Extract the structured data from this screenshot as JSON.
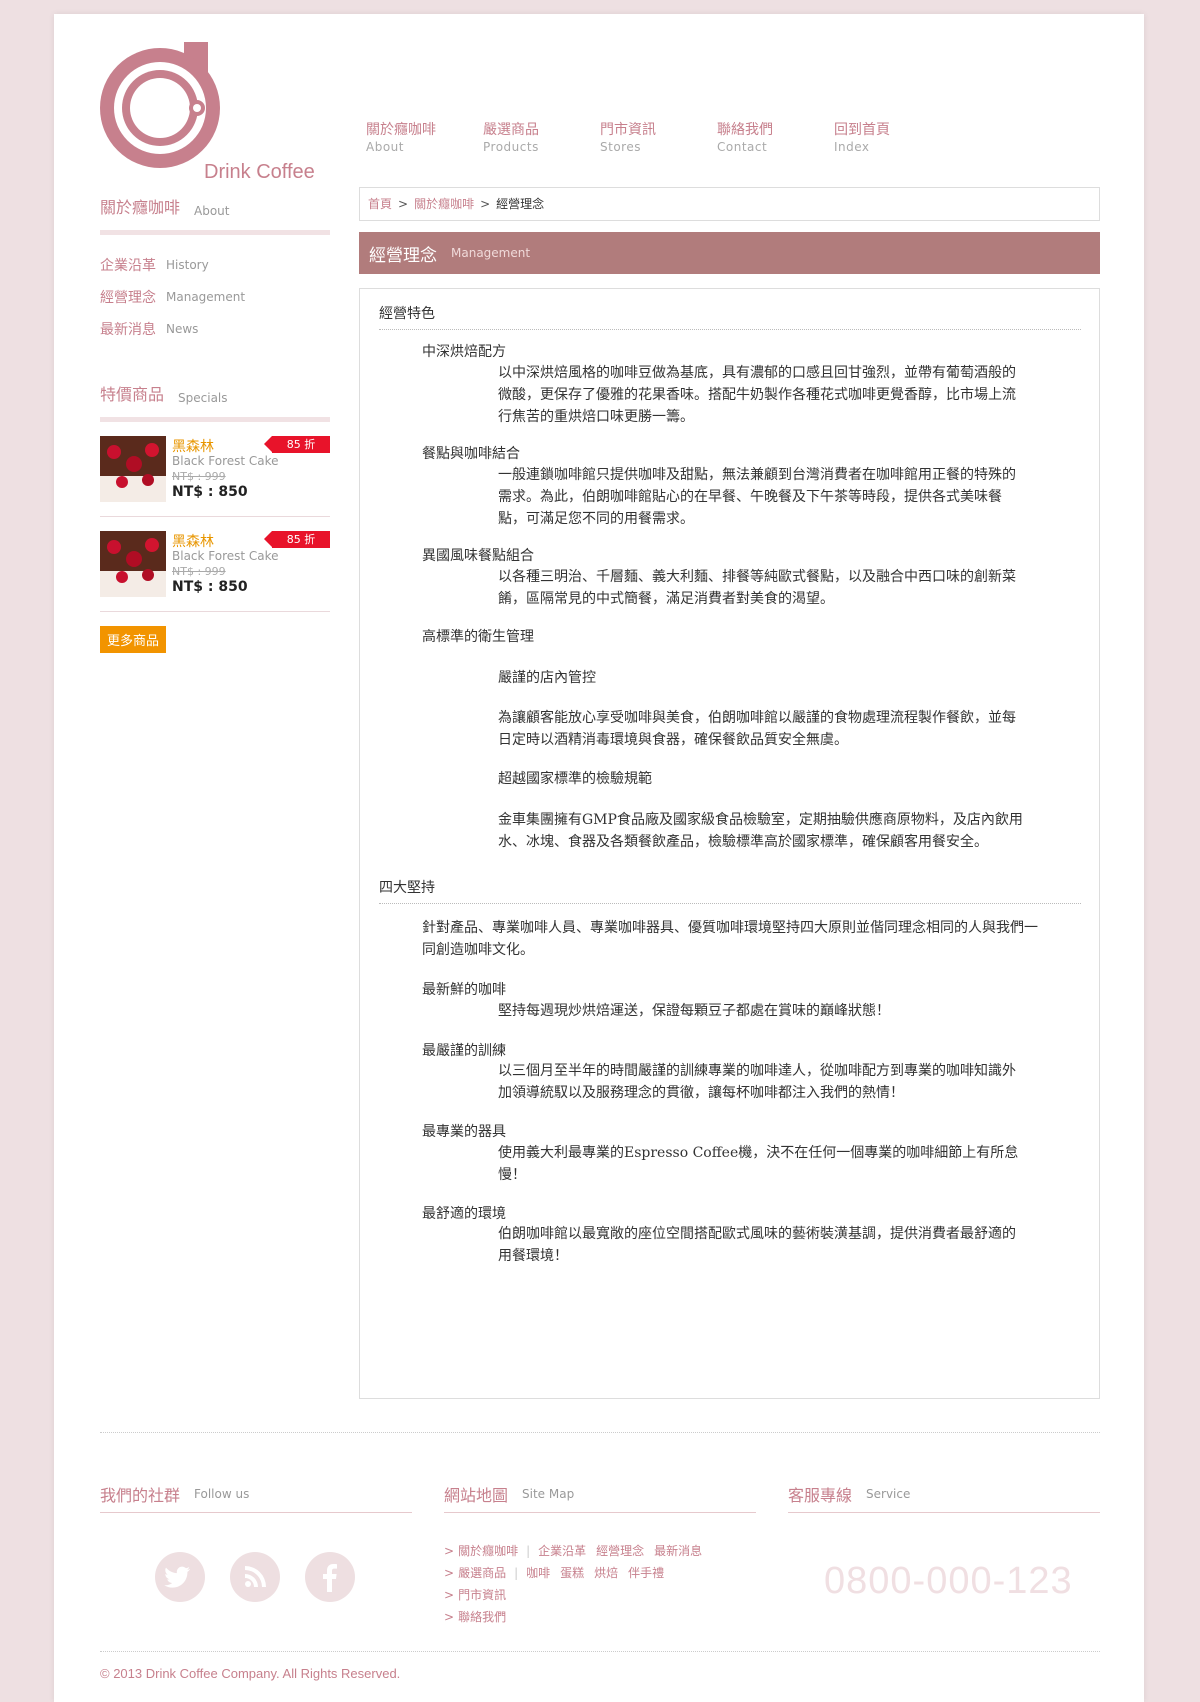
{
  "brand": {
    "name": "Drink Coffee"
  },
  "nav": [
    {
      "zh": "關於癮咖啡",
      "en": "About"
    },
    {
      "zh": "嚴選商品",
      "en": "Products"
    },
    {
      "zh": "門市資訊",
      "en": "Stores"
    },
    {
      "zh": "聯絡我們",
      "en": "Contact"
    },
    {
      "zh": "回到首頁",
      "en": "Index"
    }
  ],
  "sidebar": {
    "about": {
      "zh": "關於癮咖啡",
      "en": "About"
    },
    "menu": [
      {
        "zh": "企業沿革",
        "en": "History"
      },
      {
        "zh": "經營理念",
        "en": "Management"
      },
      {
        "zh": "最新消息",
        "en": "News"
      }
    ],
    "specials": {
      "zh": "特價商品",
      "en": "Specials"
    },
    "products": [
      {
        "name": "黑森林",
        "en": "Black Forest Cake",
        "old": "NT$ : 999",
        "price": "NT$ : 850",
        "badge": "85 折"
      },
      {
        "name": "黑森林",
        "en": "Black Forest Cake",
        "old": "NT$ : 999",
        "price": "NT$ : 850",
        "badge": "85 折"
      }
    ],
    "more": "更多商品"
  },
  "breadcrumb": {
    "home": "首頁",
    "sep": ">",
    "parent": "關於癮咖啡",
    "current": "經營理念"
  },
  "title": {
    "zh": "經營理念",
    "en": "Management"
  },
  "content": {
    "sec1": "經營特色",
    "s1": {
      "t1": "中深烘焙配方",
      "p1": "以中深烘焙風格的咖啡豆做為基底，具有濃郁的口感且回甘強烈，並帶有葡萄酒般的微酸，更保存了優雅的花果香味。搭配牛奶製作各種花式咖啡更覺香醇，比市場上流行焦苦的重烘焙口味更勝一籌。",
      "t2": "餐點與咖啡結合",
      "p2": "一般連鎖咖啡館只提供咖啡及甜點，無法兼顧到台灣消費者在咖啡館用正餐的特殊的需求。為此，伯朗咖啡館貼心的在早餐、午晚餐及下午茶等時段，提供各式美味餐點，可滿足您不同的用餐需求。",
      "t3": "異國風味餐點組合",
      "p3": "以各種三明治、千層麵、義大利麵、排餐等純歐式餐點，以及融合中西口味的創新菜餚，區隔常見的中式簡餐，滿足消費者對美食的渴望。",
      "t4": "高標準的衛生管理",
      "p4a": "嚴謹的店內管控",
      "p4b": "為讓顧客能放心享受咖啡與美食，伯朗咖啡館以嚴謹的食物處理流程製作餐飲，並每日定時以酒精消毒環境與食器，確保餐飲品質安全無虞。",
      "p4c": "超越國家標準的檢驗規範",
      "p4d": "金車集團擁有GMP食品廠及國家級食品檢驗室，定期抽驗供應商原物料，及店內飲用水、冰塊、食器及各類餐飲產品，檢驗標準高於國家標準，確保顧客用餐安全。"
    },
    "sec2": "四大堅持",
    "s2": {
      "intro": "針對產品、專業咖啡人員、專業咖啡器具、優質咖啡環境堅持四大原則並偕同理念相同的人與我們一同創造咖啡文化。",
      "t1": "最新鮮的咖啡",
      "p1": "堅持每週現炒烘焙運送，保證每顆豆子都處在賞味的巔峰狀態！",
      "t2": "最嚴謹的訓練",
      "p2": "以三個月至半年的時間嚴謹的訓練專業的咖啡達人，從咖啡配方到專業的咖啡知識外加領導統馭以及服務理念的貫徹，讓每杯咖啡都注入我們的熱情！",
      "t3": "最專業的器具",
      "p3": "使用義大利最專業的Espresso Coffee機，決不在任何一個專業的咖啡細節上有所怠慢！",
      "t4": "最舒適的環境",
      "p4": "伯朗咖啡館以最寬敞的座位空間搭配歐式風味的藝術裝潢基調，提供消費者最舒適的用餐環境！"
    }
  },
  "footer": {
    "social": {
      "zh": "我們的社群",
      "en": "Follow us"
    },
    "sitemap": {
      "zh": "網站地圖",
      "en": "Site Map"
    },
    "service": {
      "zh": "客服專線",
      "en": "Service"
    },
    "links": {
      "about": "關於癮咖啡",
      "history": "企業沿革",
      "management": "經營理念",
      "news": "最新消息",
      "products": "嚴選商品",
      "coffee": "咖啡",
      "cake": "蛋糕",
      "roast": "烘焙",
      "gift": "伴手禮",
      "stores": "門市資訊",
      "contact": "聯絡我們"
    },
    "phone": "0800-000-123",
    "copyright": "© 2013 Drink Coffee Company. All Rights Reserved."
  }
}
